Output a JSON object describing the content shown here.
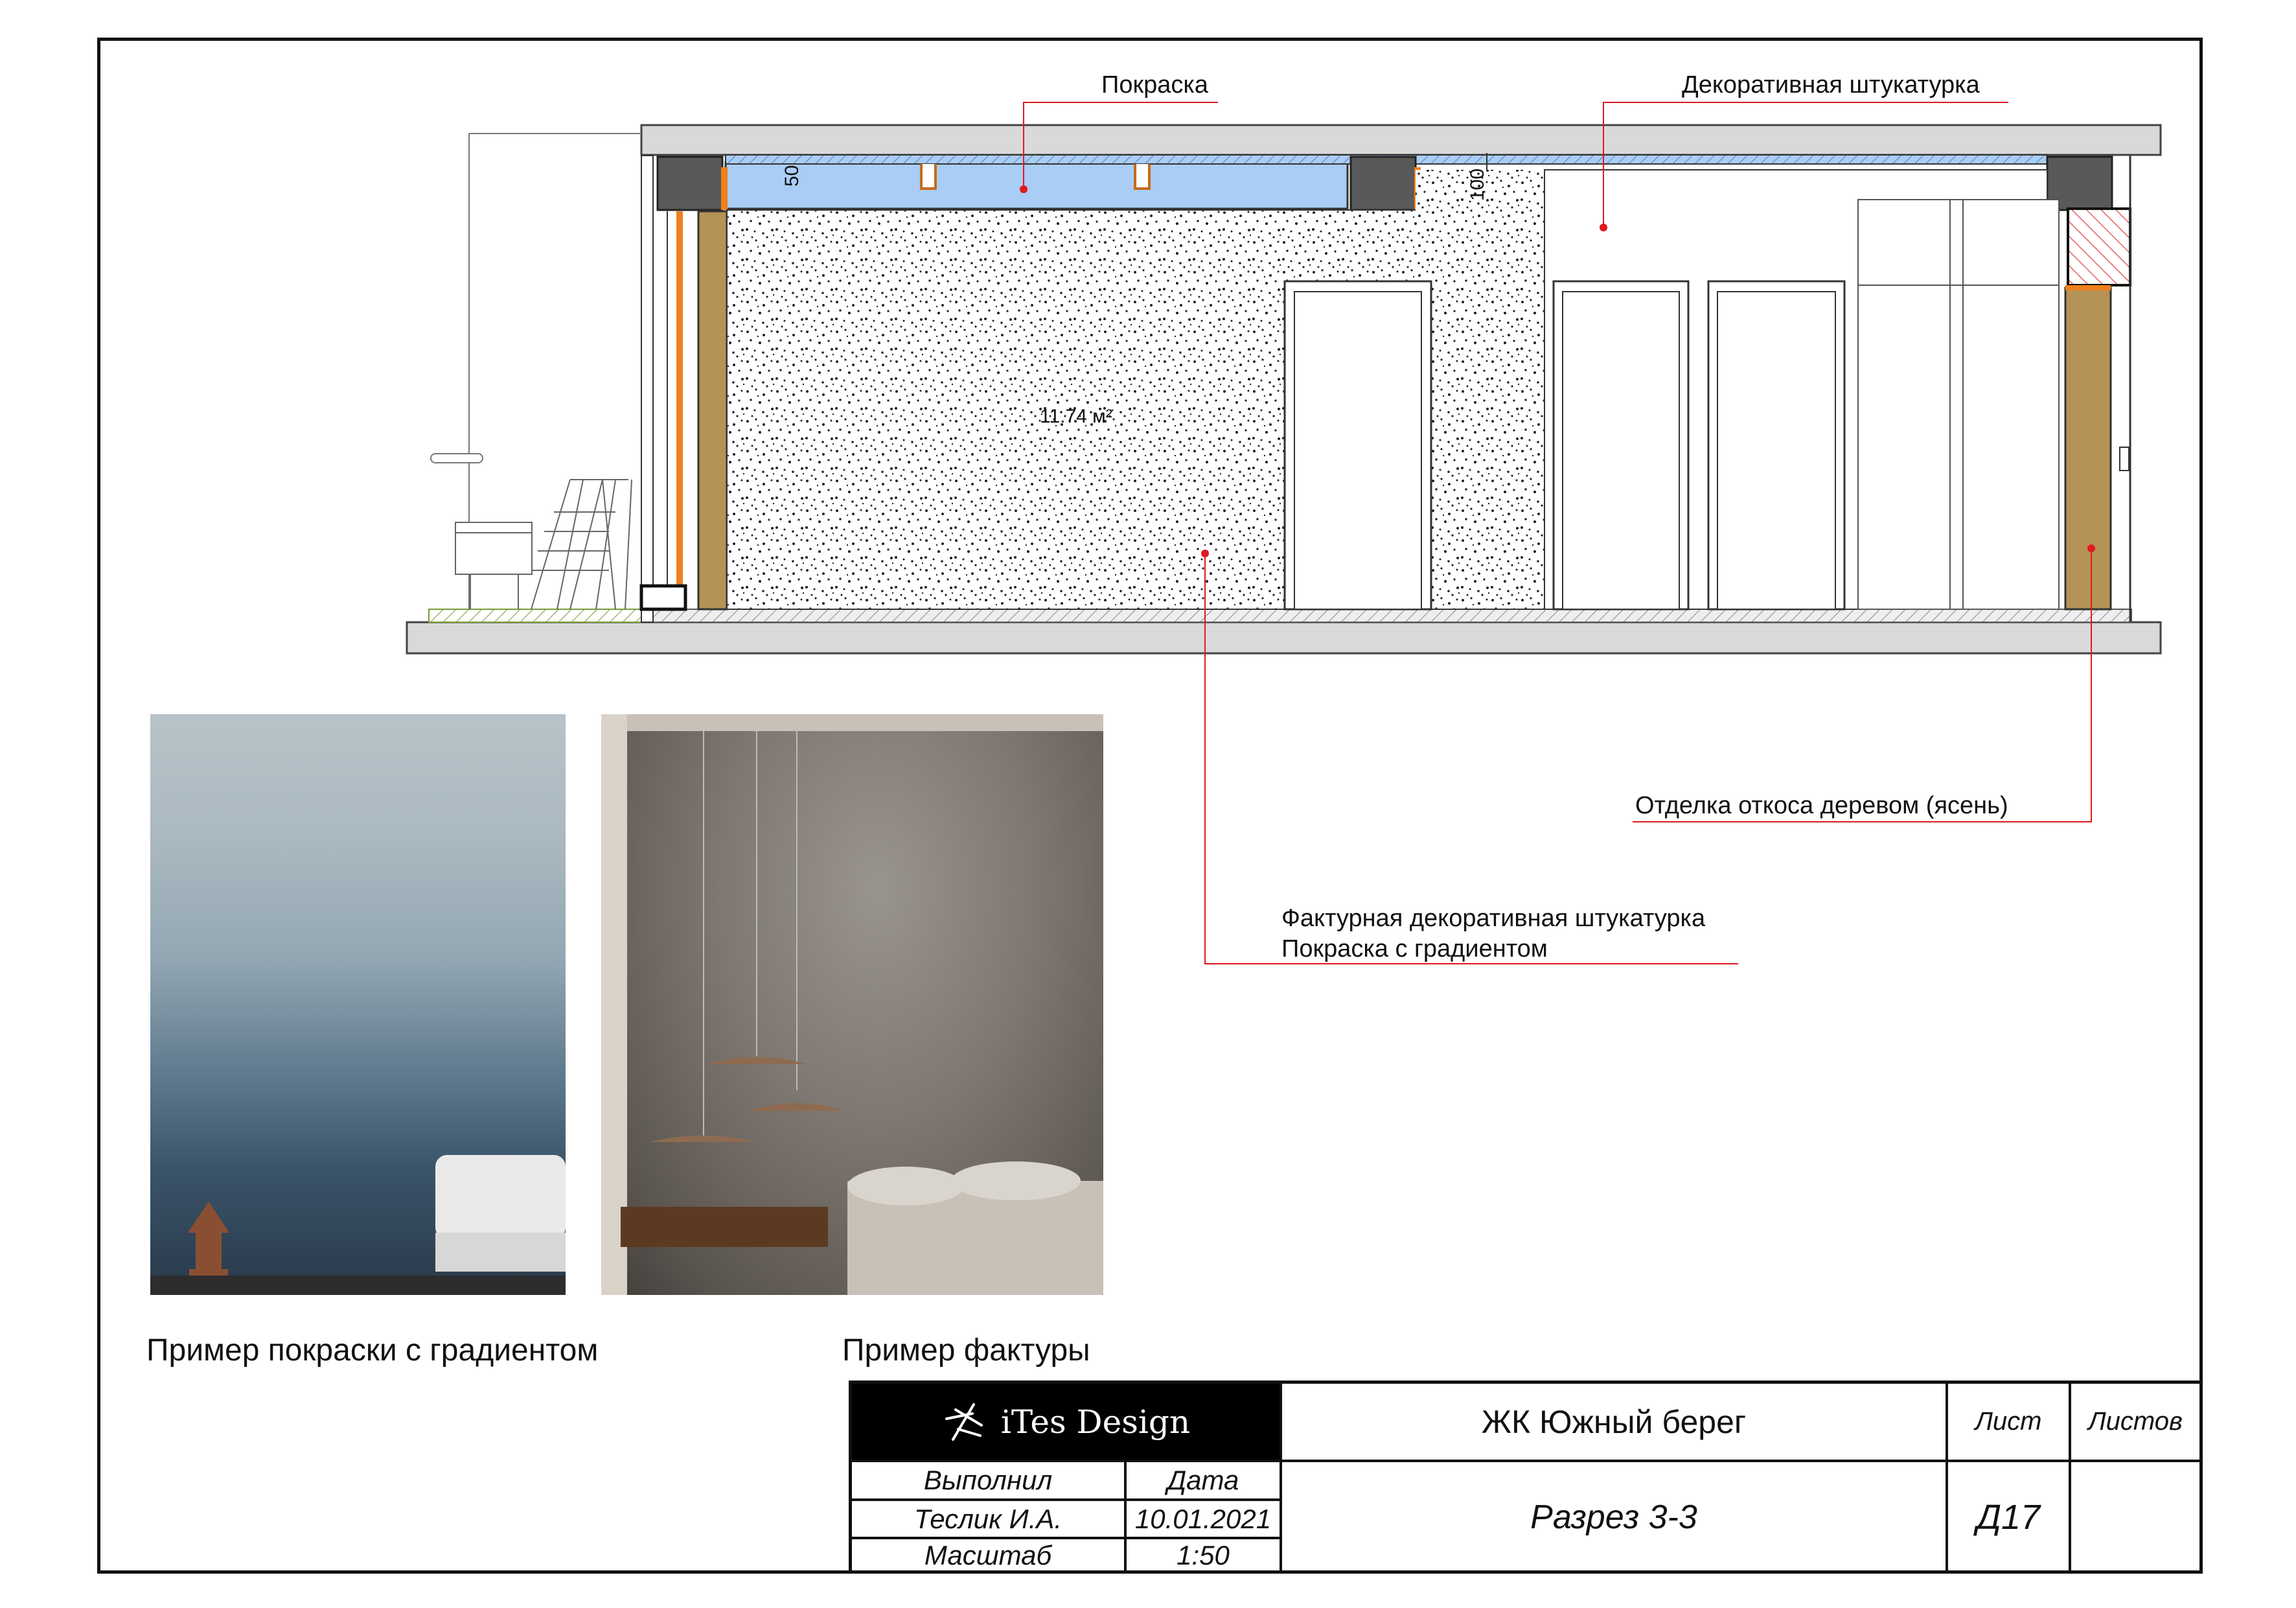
{
  "callouts": {
    "paint": "Покраска",
    "decor_plaster": "Декоративная штукатурка",
    "wood_trim": "Отделка откоса деревом (ясень)",
    "texture_line1": "Фактурная декоративная штукатурка",
    "texture_line2": "Покраска с градиентом"
  },
  "dimensions": {
    "d50": "50",
    "d100": "100",
    "area": "11.74 м²"
  },
  "captions": {
    "gradient": "Пример покраски с градиентом",
    "texture": "Пример фактуры"
  },
  "title_block": {
    "logo": "iTes Design",
    "project": "ЖК Южный берег",
    "sheet_label": "Лист",
    "sheets_label": "Листов",
    "performed_label": "Выполнил",
    "date_label": "Дата",
    "author": "Теслик И.А.",
    "date": "10.01.2021",
    "scale_label": "Масштаб",
    "scale": "1:50",
    "drawing_name": "Разрез 3-3",
    "sheet_number": "Д17",
    "sheets_total": ""
  },
  "colors": {
    "marker_red": "#e0191f",
    "ceiling_blue": "#a9cdf5",
    "wood": "#b59255",
    "slab_gray": "#d9d9d9",
    "column_dark": "#595959",
    "orange": "#f07f1e"
  }
}
